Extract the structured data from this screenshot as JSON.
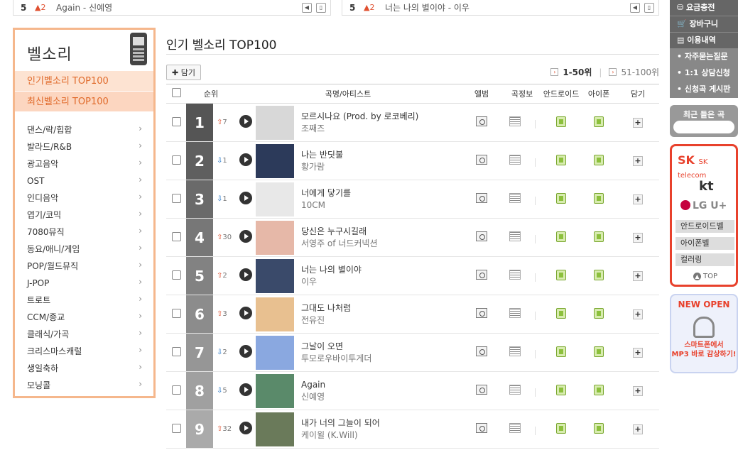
{
  "top_strip": [
    {
      "rank": "5",
      "change": "2",
      "text": "Again - 신예영"
    },
    {
      "rank": "5",
      "change": "2",
      "text": "너는 나의 별이야 - 이우"
    }
  ],
  "sidebar": {
    "title": "벨소리",
    "menu": [
      "인기벨소리 TOP100",
      "최신벨소리 TOP100"
    ],
    "genres": [
      "댄스/락/힙합",
      "발라드/R&B",
      "광고음악",
      "OST",
      "인디음악",
      "엽기/코믹",
      "7080뮤직",
      "동요/애니/게임",
      "POP/월드뮤직",
      "J-POP",
      "트로트",
      "CCM/종교",
      "클래식/가곡",
      "크리스마스캐럴",
      "생일축하",
      "모닝콜"
    ]
  },
  "main": {
    "title": "인기 벨소리 TOP100",
    "add_button": "담기",
    "pager": {
      "current": "1-50위",
      "other": "51-100위"
    },
    "columns": [
      "순위",
      "곡명/아티스트",
      "앨범",
      "곡정보",
      "안드로이드",
      "아이폰",
      "담기"
    ],
    "rows": [
      {
        "rank": "1",
        "dir": "up",
        "change": "7",
        "song": "모르시나요 (Prod. by 로코베리)",
        "artist": "조째즈",
        "rank_color": "#555555",
        "thumb": "#d8d8d8"
      },
      {
        "rank": "2",
        "dir": "down",
        "change": "1",
        "song": "나는 반딧불",
        "artist": "황가람",
        "rank_color": "#5f5f5f",
        "thumb": "#2c3a5a"
      },
      {
        "rank": "3",
        "dir": "down",
        "change": "1",
        "song": "너에게 닿기를",
        "artist": "10CM",
        "rank_color": "#6a6a6a",
        "thumb": "#e8e8e8"
      },
      {
        "rank": "4",
        "dir": "up",
        "change": "30",
        "song": "당신은 누구시길래",
        "artist": "서영주 of 너드커넥션",
        "rank_color": "#777777",
        "thumb": "#e6b8a8"
      },
      {
        "rank": "5",
        "dir": "up",
        "change": "2",
        "song": "너는 나의 별이야",
        "artist": "이우",
        "rank_color": "#828282",
        "thumb": "#3a4a6a"
      },
      {
        "rank": "6",
        "dir": "up",
        "change": "3",
        "song": "그대도 나처럼",
        "artist": "전유진",
        "rank_color": "#8c8c8c",
        "thumb": "#e8c090"
      },
      {
        "rank": "7",
        "dir": "down",
        "change": "2",
        "song": "그날이 오면",
        "artist": "투모로우바이투게더",
        "rank_color": "#969696",
        "thumb": "#8aa8e0"
      },
      {
        "rank": "8",
        "dir": "down",
        "change": "5",
        "song": "Again",
        "artist": "신예영",
        "rank_color": "#a0a0a0",
        "thumb": "#5a8a6a"
      },
      {
        "rank": "9",
        "dir": "up",
        "change": "32",
        "song": "내가 너의 그늘이 되어",
        "artist": "케이윌 (K.Will)",
        "rank_color": "#aaaaaa",
        "thumb": "#6a7a5a"
      }
    ]
  },
  "rail": {
    "buttons": [
      "요금충전",
      "장바구니",
      "이용내역"
    ],
    "links": [
      "자주묻는질문",
      "1:1 상담신청",
      "신청곡 게시판"
    ],
    "recent_label": "최근 들은 곡",
    "carriers": [
      "SK telecom",
      "kt",
      "LG U+"
    ],
    "carrier_buttons": [
      "안드로이드벨",
      "아이폰벨",
      "컬러링"
    ],
    "top_label": "TOP",
    "promo_title": "NEW OPEN",
    "promo_lines": [
      "스마트폰에서",
      "MP3 바로 감상하기!"
    ]
  },
  "colors": {
    "accent": "#e05030",
    "up": "#e05030",
    "down": "#2a78c8",
    "sidebar_border": "#f5b78c"
  }
}
